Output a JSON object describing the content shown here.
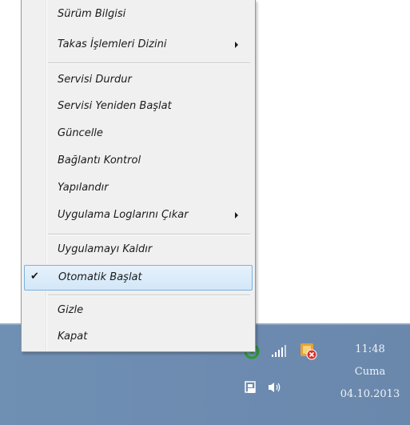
{
  "menu": {
    "items": [
      {
        "label": "Sürüm Bilgisi"
      },
      {
        "label": "Takas İşlemleri Dizini"
      },
      {
        "label": "Servisi Durdur"
      },
      {
        "label": "Servisi Yeniden Başlat"
      },
      {
        "label": "Güncelle"
      },
      {
        "label": "Bağlantı Kontrol"
      },
      {
        "label": "Yapılandır"
      },
      {
        "label": "Uygulama Loglarını Çıkar"
      },
      {
        "label": "Uygulamayı Kaldır"
      },
      {
        "label": "Otomatik Başlat",
        "checked": true,
        "selected": true
      },
      {
        "label": "Gizle"
      },
      {
        "label": "Kapat"
      }
    ]
  },
  "taskbar": {
    "time": "11:48",
    "day": "Cuma",
    "date": "04.10.2013",
    "accent_color": "#6d8bb0"
  }
}
